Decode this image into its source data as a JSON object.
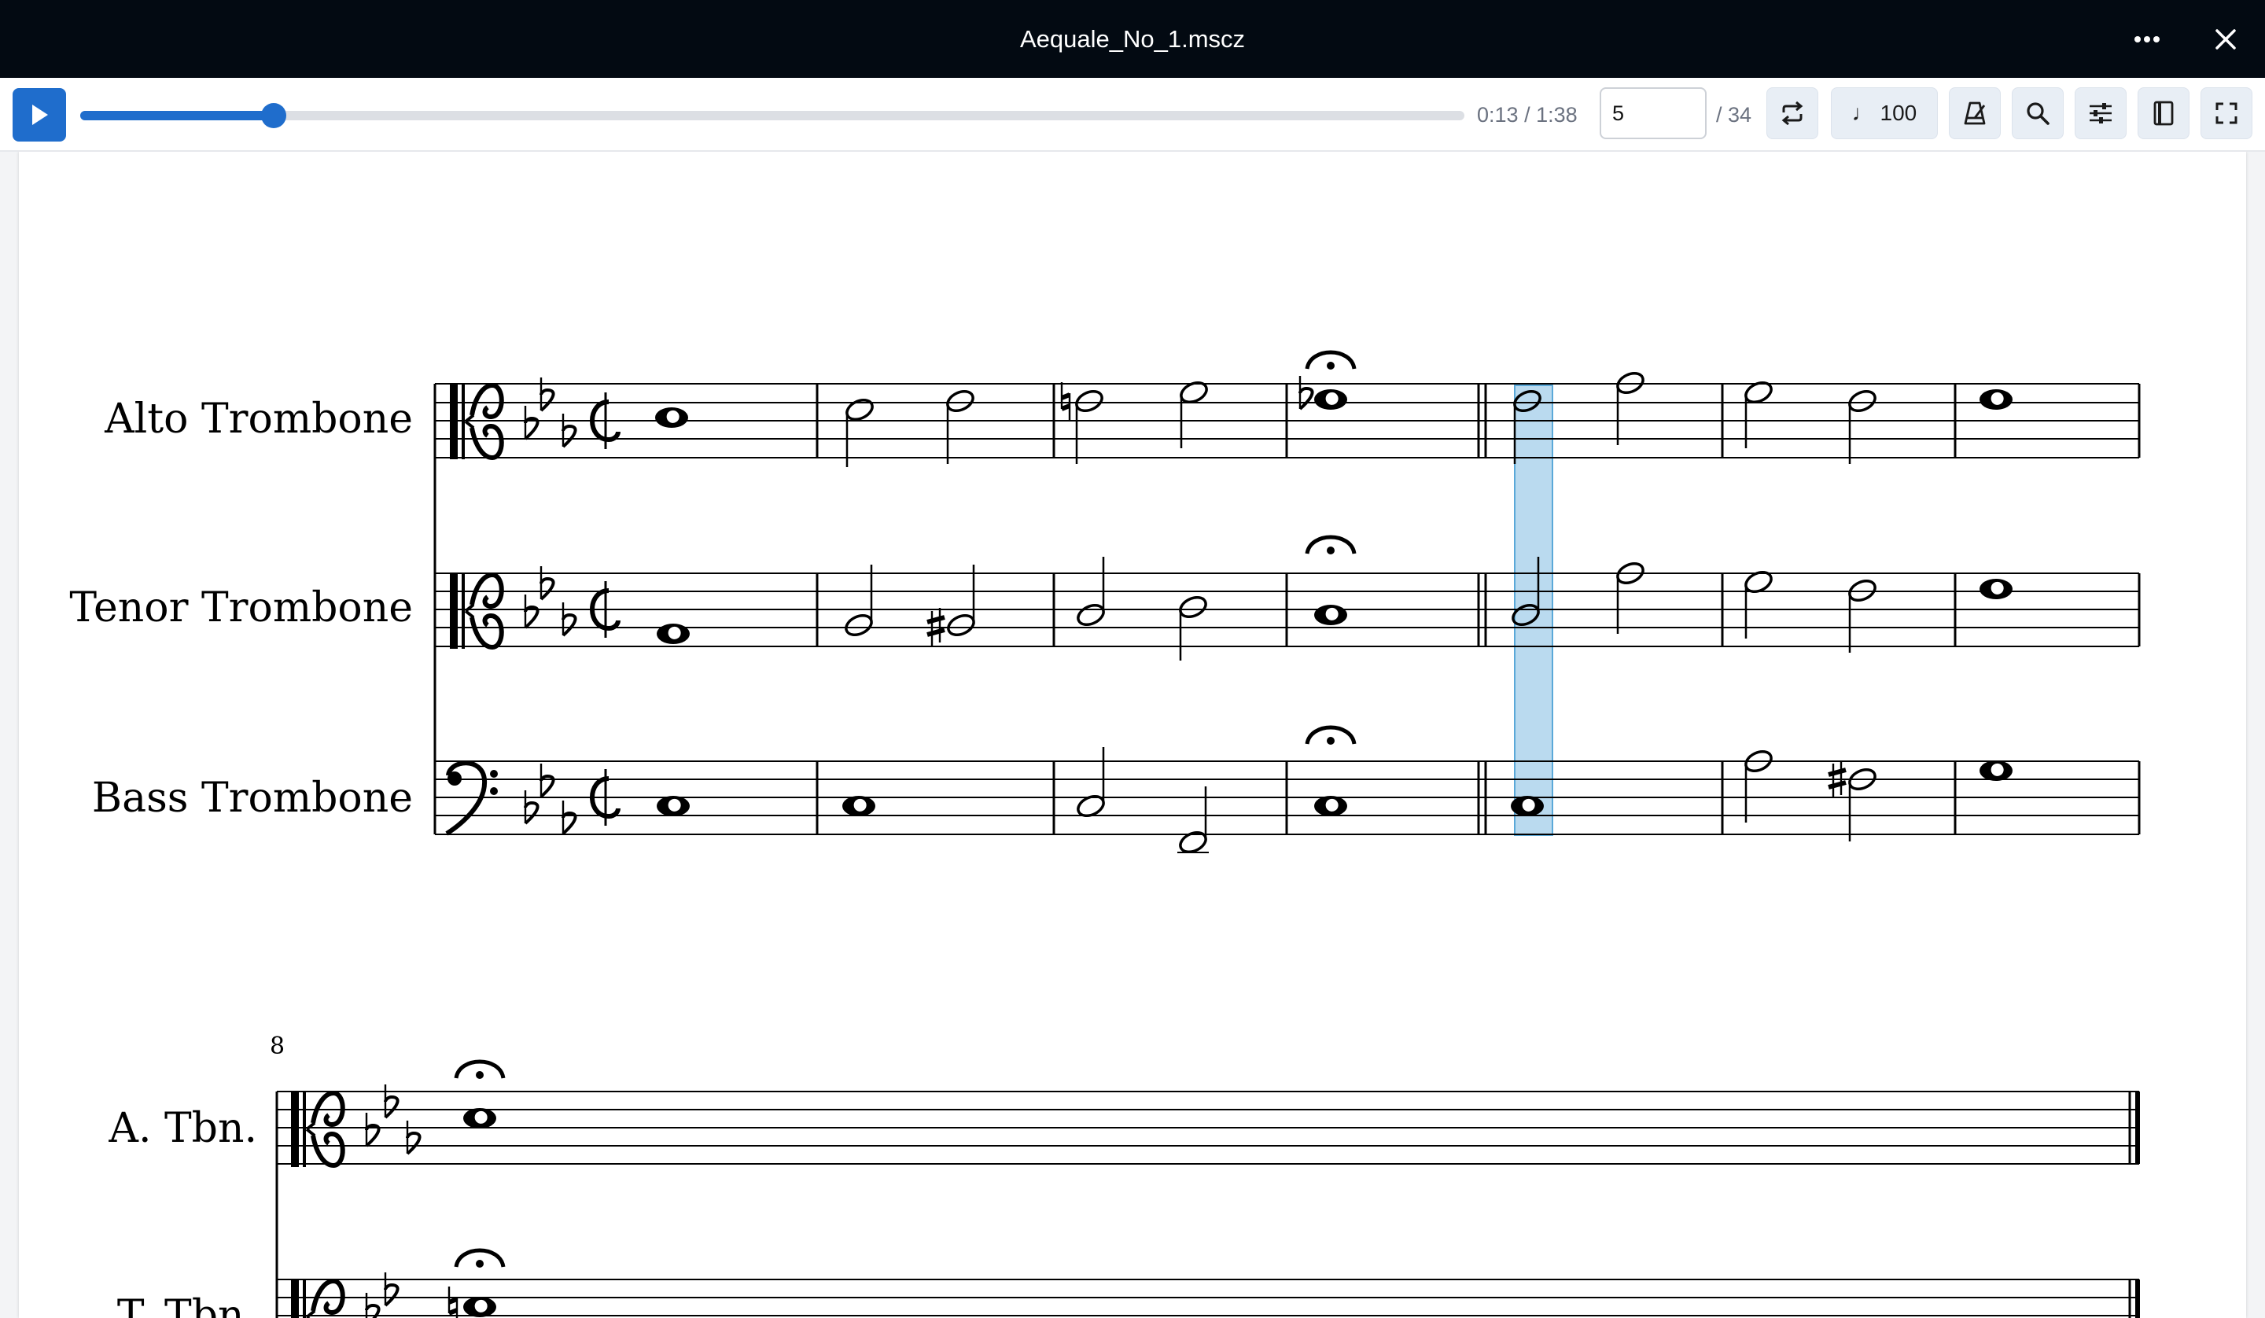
{
  "window": {
    "title": "Aequale_No_1.mscz"
  },
  "player": {
    "progress": 0.14,
    "time_current": "0:13",
    "time_total": "1:38",
    "time_separator": "/",
    "measure_value": "5",
    "measure_total": "/ 34",
    "tempo_label": "♩ 100"
  },
  "score": {
    "system1_instruments": [
      "Alto Trombone",
      "Tenor Trombone",
      "Bass Trombone"
    ],
    "system2_instruments": [
      "A. Tbn.",
      "T. Tbn."
    ],
    "system2_measure_number": "8",
    "selected_measure": 5
  },
  "colors": {
    "accent": "#1f6dcc",
    "titlebar": "#030a12",
    "selection": "#9ccbe8"
  }
}
